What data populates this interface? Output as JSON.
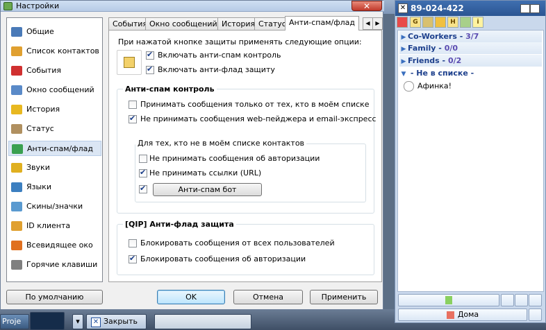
{
  "window": {
    "title": "Настройки",
    "close_glyph": "✕"
  },
  "sidebar": {
    "items": [
      {
        "label": "Общие",
        "icon": "settings-icon",
        "color": "#4a7ab8"
      },
      {
        "label": "Список контактов",
        "icon": "contacts-icon",
        "color": "#e0a030"
      },
      {
        "label": "События",
        "icon": "star-icon",
        "color": "#d03030"
      },
      {
        "label": "Окно сообщений",
        "icon": "message-window-icon",
        "color": "#5a8ac8"
      },
      {
        "label": "История",
        "icon": "history-icon",
        "color": "#e8b820"
      },
      {
        "label": "Статус",
        "icon": "status-icon",
        "color": "#b09060"
      },
      {
        "label": "Анти-спам/флад",
        "icon": "antispam-icon",
        "color": "#3aa050"
      },
      {
        "label": "Звуки",
        "icon": "sound-icon",
        "color": "#e0b020"
      },
      {
        "label": "Языки",
        "icon": "languages-icon",
        "color": "#3c7fc0"
      },
      {
        "label": "Скины/значки",
        "icon": "skins-icon",
        "color": "#5a9ad0"
      },
      {
        "label": "ID клиента",
        "icon": "client-id-icon",
        "color": "#e0a030"
      },
      {
        "label": "Всевидящее око",
        "icon": "eye-icon",
        "color": "#e07020"
      },
      {
        "label": "Горячие клавиши",
        "icon": "hotkeys-icon",
        "color": "#808080"
      }
    ],
    "selected_index": 6
  },
  "tabs": [
    "События",
    "Окно сообщений",
    "История",
    "Статус",
    "Анти-спам/флад"
  ],
  "active_tab": "Анти-спам/флад",
  "panel": {
    "intro": "При нажатой кнопке защиты применять следующие опции:",
    "top_options": [
      {
        "label": "Включать анти-спам контроль",
        "checked": true
      },
      {
        "label": "Включать анти-флад защиту",
        "checked": true
      }
    ],
    "antispam": {
      "title": "Анти-спам контроль",
      "options": [
        {
          "label": "Принимать сообщения только от тех, кто в моём списке",
          "checked": false
        },
        {
          "label": "Не принимать сообщения web-пейджера и email-экспресс",
          "checked": true
        }
      ],
      "sub": {
        "title": "Для тех, кто не в моём списке контактов",
        "options": [
          {
            "label": "Не принимать сообщения об авторизации",
            "checked": false
          },
          {
            "label": "Не принимать ссылки (URL)",
            "checked": true
          }
        ],
        "bot_checked": true,
        "bot_button": "Анти-спам бот"
      }
    },
    "antiflood": {
      "title": "[QIP] Анти-флад защита",
      "options": [
        {
          "label": "Блокировать сообщения от всех пользователей",
          "checked": false
        },
        {
          "label": "Блокировать сообщения об авторизации",
          "checked": true
        }
      ]
    }
  },
  "footer": {
    "default": "По умолчанию",
    "ok": "OK",
    "cancel": "Отмена",
    "apply": "Применить"
  },
  "qip": {
    "uin": "89-024-422",
    "groups": [
      {
        "name": "Co-Workers",
        "count": "3/7"
      },
      {
        "name": "Family",
        "count": "0/0"
      },
      {
        "name": "Friends",
        "count": "0/2"
      },
      {
        "name": "Не в списке",
        "count": ""
      }
    ],
    "contact": "Афинка!",
    "status": "Дома"
  },
  "taskbar": {
    "app_label": "Proje",
    "close_label": "Закрыть"
  }
}
